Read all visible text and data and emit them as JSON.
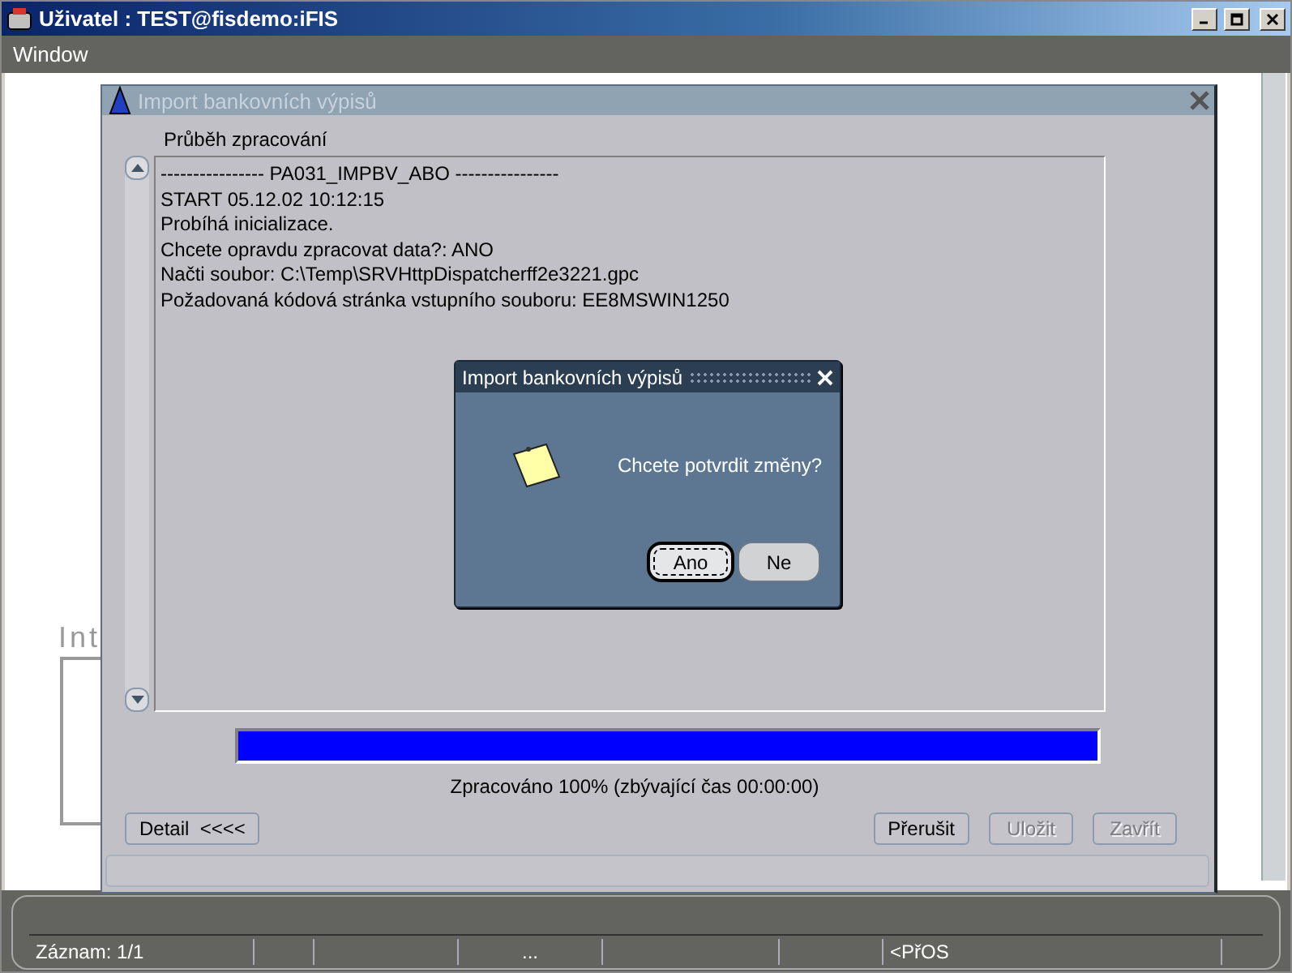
{
  "window": {
    "title": "Uživatel : TEST@fisdemo:iFIS"
  },
  "menu": [
    {
      "label": "Window"
    }
  ],
  "background_form": {
    "label": "Int"
  },
  "import_window": {
    "title": "Import bankovních výpisů",
    "active": false,
    "log_label": "Průběh zpracování",
    "log_lines": [
      "---------------- PA031_IMPBV_ABO ----------------",
      "START 05.12.02 10:12:15",
      "Probíhá inicializace.",
      "Chcete opravdu zpracovat data?: ANO",
      "Načti soubor: C:\\Temp\\SRVHttpDispatcherff2e3221.gpc",
      "Požadovaná kódová stránka vstupního souboru: EE8MSWIN1250"
    ],
    "progress": {
      "level": 1
    },
    "progress_text": "Zpracováno 100% (zbývající čas 00:00:00)",
    "detail_button": {
      "label": "Detail  <<<<",
      "disabled": false
    },
    "buttons": [
      {
        "label": "Přerušit",
        "disabled": false
      },
      {
        "label": "Uložit",
        "disabled": true
      },
      {
        "label": "Zavřít",
        "disabled": true
      }
    ]
  },
  "dialog": {
    "title": "Import bankovních výpisů",
    "message": "Chcete potvrdit změny?",
    "buttons": [
      {
        "label": "Ano",
        "focused": true
      },
      {
        "label": "Ne",
        "focused": false
      }
    ]
  },
  "status_bar": {
    "fields": [
      "Záznam: 1/1",
      "...",
      "<PřOS"
    ]
  }
}
